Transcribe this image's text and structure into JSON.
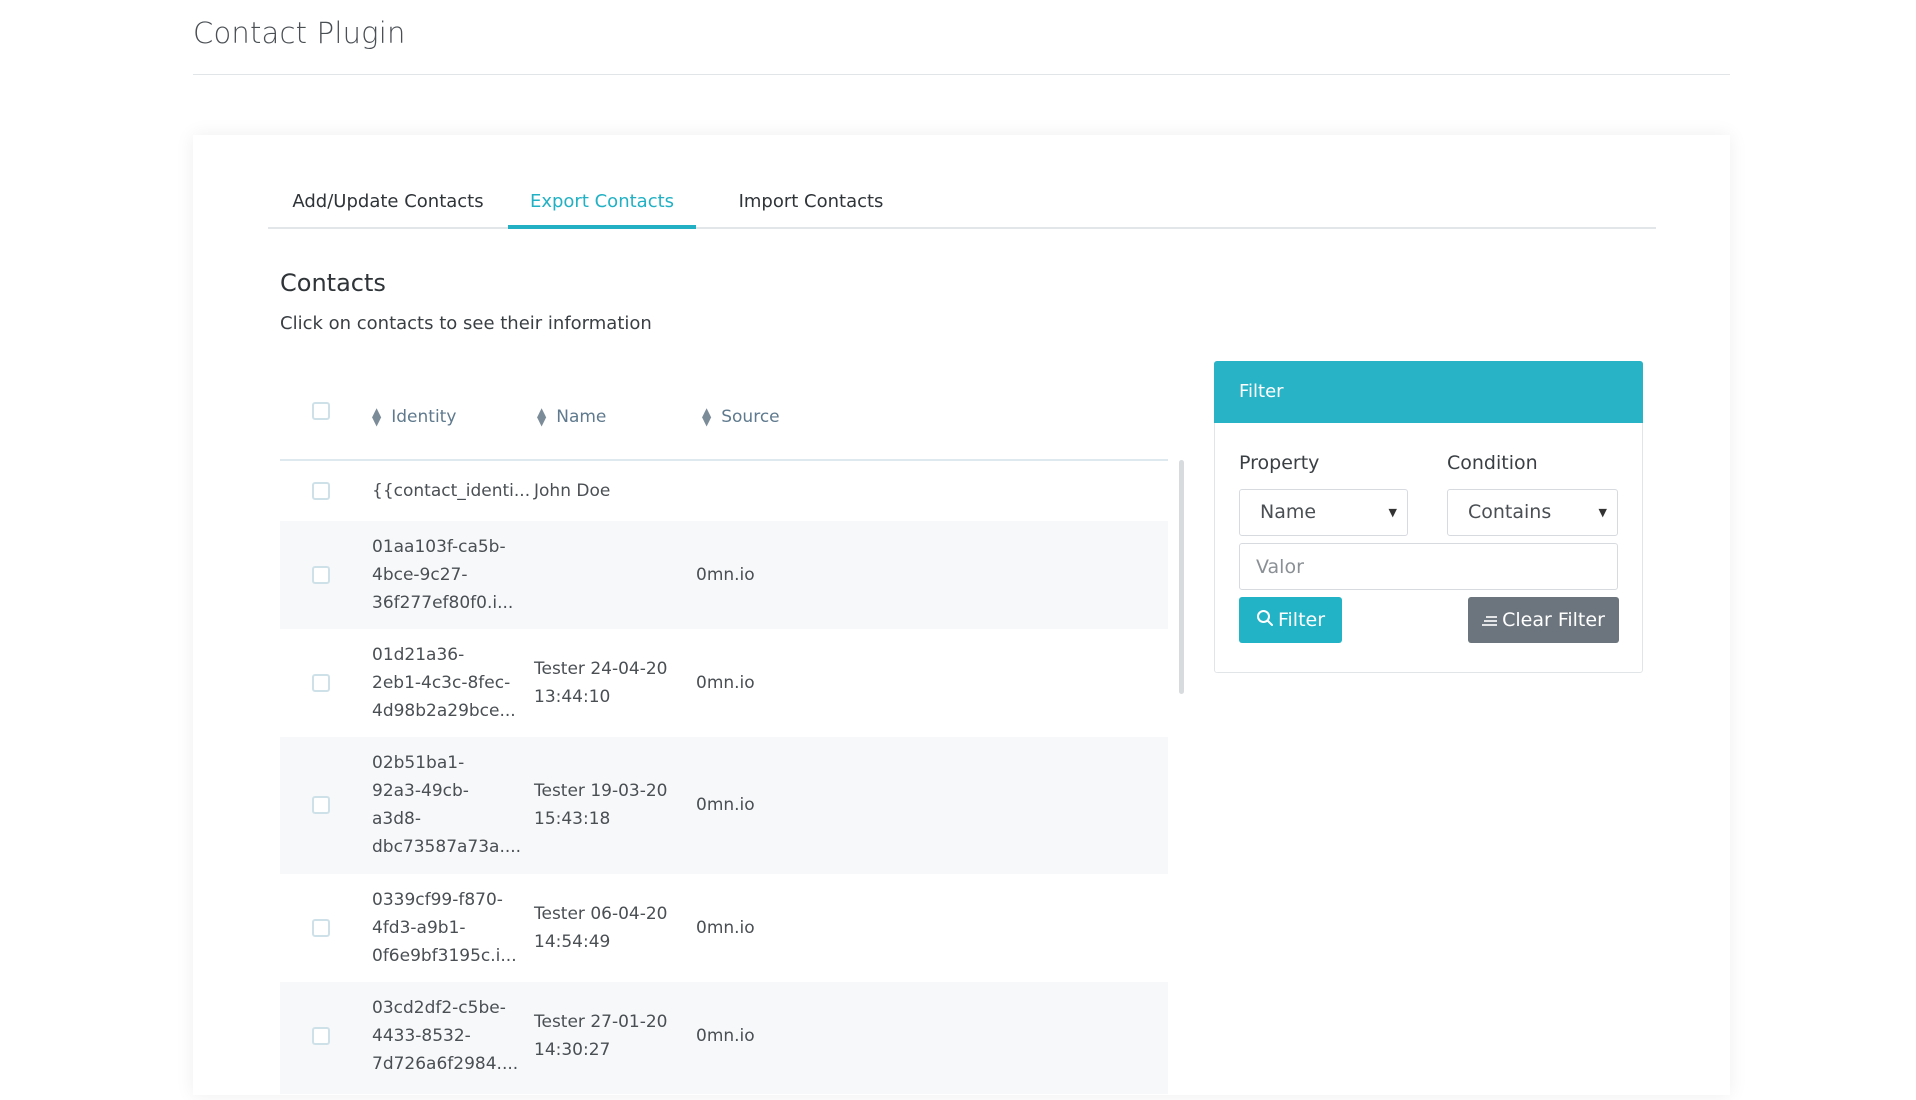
{
  "page": {
    "title": "Contact Plugin"
  },
  "tabs": [
    {
      "label": "Add/Update Contacts",
      "active": false
    },
    {
      "label": "Export Contacts",
      "active": true
    },
    {
      "label": "Import Contacts",
      "active": false
    }
  ],
  "contacts": {
    "title": "Contacts",
    "subtitle": "Click on contacts to see their information",
    "columns": [
      "Identity",
      "Name",
      "Source"
    ],
    "rows": [
      {
        "identity": [
          "{{contact_identi..."
        ],
        "name": [
          "John Doe"
        ],
        "source": ""
      },
      {
        "identity": [
          "01aa103f-ca5b-",
          "4bce-9c27-",
          "36f277ef80f0.i..."
        ],
        "name": [],
        "source": "0mn.io"
      },
      {
        "identity": [
          "01d21a36-",
          "2eb1-4c3c-8fec-",
          "4d98b2a29bce..."
        ],
        "name": [
          "Tester 24-04-20",
          "13:44:10"
        ],
        "source": "0mn.io"
      },
      {
        "identity": [
          "02b51ba1-",
          "92a3-49cb-",
          "a3d8-",
          "dbc73587a73a...."
        ],
        "name": [
          "Tester 19-03-20",
          "15:43:18"
        ],
        "source": "0mn.io"
      },
      {
        "identity": [
          "0339cf99-f870-",
          "4fd3-a9b1-",
          "0f6e9bf3195c.i..."
        ],
        "name": [
          "Tester 06-04-20",
          "14:54:49"
        ],
        "source": "0mn.io"
      },
      {
        "identity": [
          "03cd2df2-c5be-",
          "4433-8532-",
          "7d726a6f2984...."
        ],
        "name": [
          "Tester 27-01-20",
          "14:30:27"
        ],
        "source": "0mn.io"
      }
    ]
  },
  "filter": {
    "title": "Filter",
    "property_label": "Property",
    "condition_label": "Condition",
    "property_value": "Name",
    "condition_value": "Contains",
    "value_placeholder": "Valor",
    "filter_button": "Filter",
    "clear_button": "Clear Filter"
  },
  "colors": {
    "accent": "#22b1c4",
    "clear_button": "#6c757d"
  },
  "icons": {
    "sort": "sort-icon",
    "search": "search-icon",
    "clear": "lines-icon",
    "caret": "caret-down-icon"
  }
}
